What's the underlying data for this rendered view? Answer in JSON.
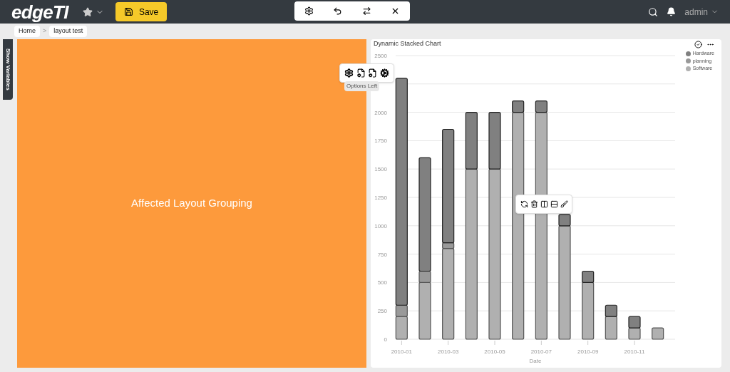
{
  "header": {
    "logo": "edgeTI",
    "save_button": "Save",
    "user": "admin"
  },
  "breadcrumb": {
    "separator": ">",
    "items": [
      {
        "label": "Home"
      },
      {
        "label": "layout test"
      }
    ]
  },
  "side_tab": "Show Variables",
  "layout_panel": {
    "label": "Affected Layout Grouping"
  },
  "options_tooltip": "Options Left",
  "chart_card": {
    "title": "Dynamic Stacked Chart",
    "chart_data": {
      "type": "bar",
      "stacked": true,
      "grid": true,
      "xlabel": "Date",
      "categories": [
        "2010-01",
        null,
        "2010-03",
        null,
        "2010-05",
        null,
        "2010-07",
        null,
        "2010-09",
        null,
        "2010-11",
        null
      ],
      "series": [
        {
          "name": "Hardware",
          "color": "#808080",
          "values": [
            2000,
            1000,
            1000,
            500,
            500,
            100,
            100,
            100,
            100,
            100,
            100,
            0
          ]
        },
        {
          "name": "planning",
          "color": "#999999",
          "values": [
            100,
            100,
            50,
            0,
            0,
            0,
            0,
            0,
            0,
            0,
            0,
            0
          ]
        },
        {
          "name": "Software",
          "color": "#b0b0b0",
          "values": [
            200,
            500,
            800,
            1500,
            1500,
            2000,
            2000,
            1000,
            500,
            200,
            100,
            100
          ]
        }
      ],
      "ylim": [
        0,
        2500
      ],
      "yticks": [
        0,
        250,
        500,
        750,
        1000,
        1250,
        1500,
        1750,
        2000,
        2500
      ]
    }
  }
}
